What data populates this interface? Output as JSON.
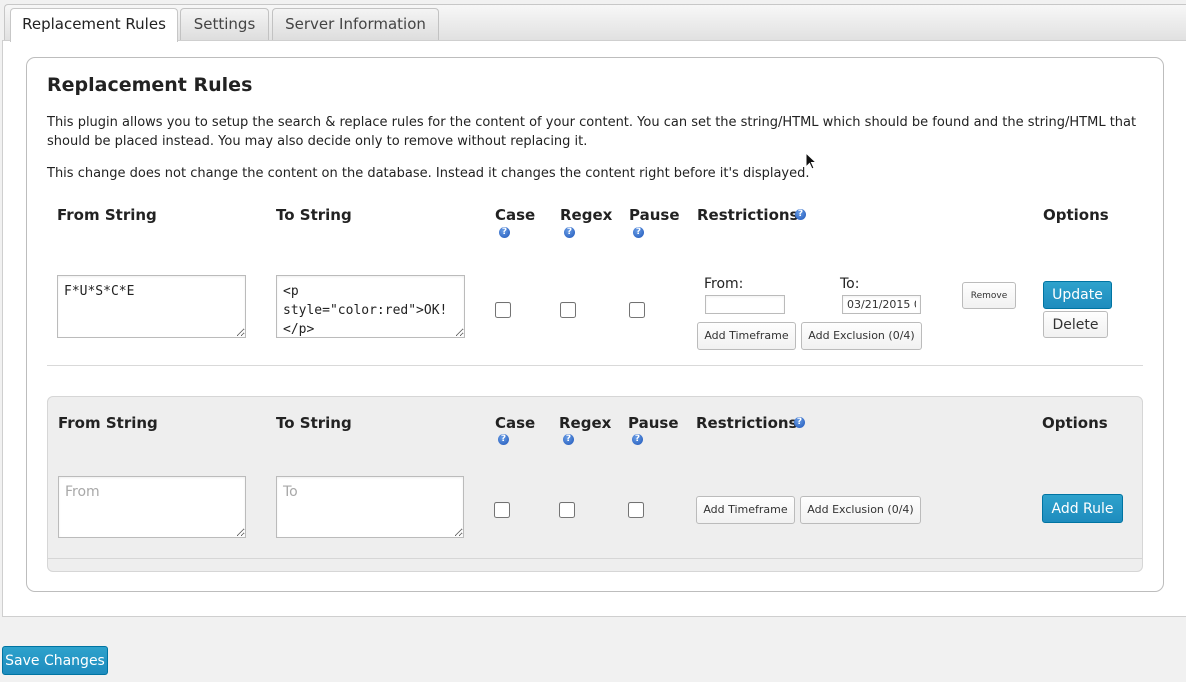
{
  "tabs": [
    {
      "label": "Replacement Rules",
      "active": true
    },
    {
      "label": "Settings",
      "active": false
    },
    {
      "label": "Server Information",
      "active": false
    }
  ],
  "section": {
    "title": "Replacement Rules",
    "description1": "This plugin allows you to setup the search & replace rules for the content of your content. You can set the string/HTML which should be found and the string/HTML that should be placed instead. You may also decide only to remove without replacing it.",
    "description2": "This change does not change the content on the database. Instead it changes the content right before it's displayed."
  },
  "columns": {
    "from": "From String",
    "to": "To String",
    "case": "Case",
    "regex": "Regex",
    "pause": "Pause",
    "restrictions": "Restrictions",
    "options": "Options"
  },
  "help_glyph": "?",
  "existing_rule": {
    "from_value": "F*U*S*C*E",
    "to_value": "<p style=\"color:red\">OK!</p>",
    "case_checked": false,
    "regex_checked": false,
    "pause_checked": false,
    "timeframe_from_label": "From:",
    "timeframe_to_label": "To:",
    "timeframe_from_value": "",
    "timeframe_to_value": "03/21/2015 0",
    "remove_label": "Remove",
    "add_timeframe_label": "Add Timeframe",
    "add_exclusion_label": "Add Exclusion (0/4)",
    "update_label": "Update",
    "delete_label": "Delete"
  },
  "new_rule": {
    "from_placeholder": "From",
    "to_placeholder": "To",
    "add_timeframe_label": "Add Timeframe",
    "add_exclusion_label": "Add Exclusion (0/4)",
    "add_rule_label": "Add Rule"
  },
  "footer": {
    "save_label": "Save Changes"
  },
  "colors": {
    "primary_button": "#1e8cbe",
    "help_icon": "#1d55b8"
  }
}
